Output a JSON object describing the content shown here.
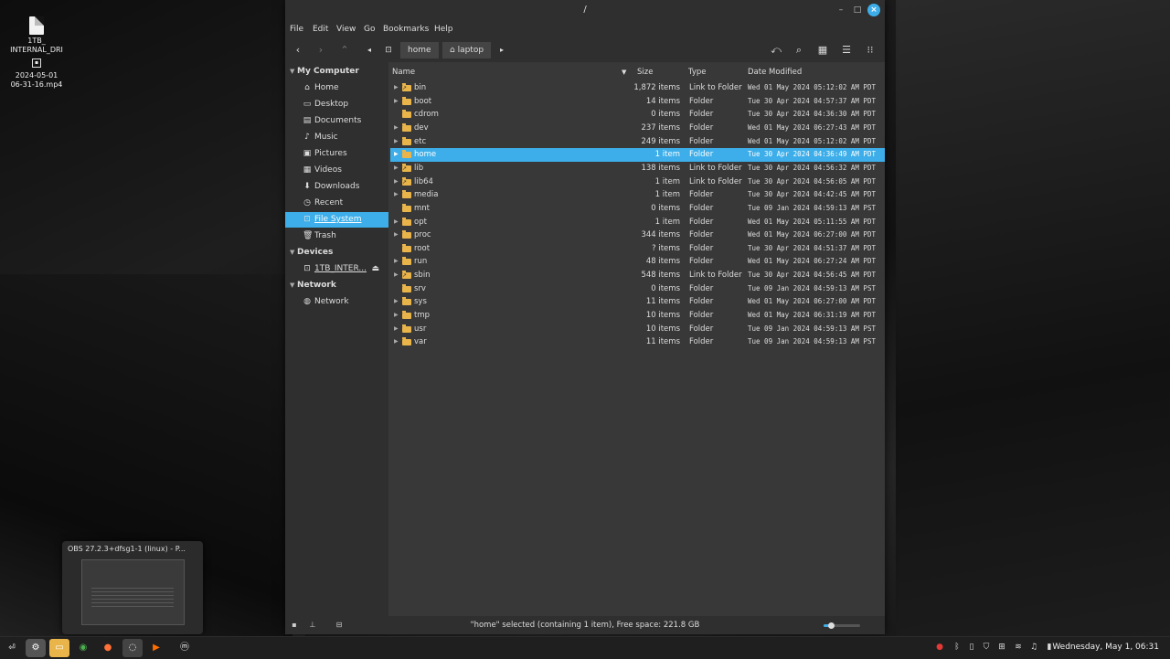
{
  "desktop": {
    "icons": [
      {
        "label": "1TB_\nINTERNAL_DRI"
      },
      {
        "label": "2024-05-01\n06-31-16.mp4"
      }
    ],
    "preview_title": "OBS 27.2.3+dfsg1-1 (linux) - P..."
  },
  "window": {
    "title": "/",
    "menu": [
      "File",
      "Edit",
      "View",
      "Go",
      "Bookmarks",
      "Help"
    ],
    "breadcrumbs": [
      "home",
      "laptop"
    ],
    "sidebar": {
      "sections": [
        {
          "title": "My Computer",
          "items": [
            {
              "label": "Home",
              "icon": "home-icon"
            },
            {
              "label": "Desktop",
              "icon": "desktop-icon"
            },
            {
              "label": "Documents",
              "icon": "documents-icon"
            },
            {
              "label": "Music",
              "icon": "music-icon"
            },
            {
              "label": "Pictures",
              "icon": "pictures-icon"
            },
            {
              "label": "Videos",
              "icon": "videos-icon"
            },
            {
              "label": "Downloads",
              "icon": "downloads-icon"
            },
            {
              "label": "Recent",
              "icon": "recent-icon"
            },
            {
              "label": "File System",
              "icon": "drive-icon",
              "selected": true
            },
            {
              "label": "Trash",
              "icon": "trash-icon"
            }
          ]
        },
        {
          "title": "Devices",
          "items": [
            {
              "label": "1TB_INTER...",
              "icon": "drive-icon",
              "eject": true
            }
          ]
        },
        {
          "title": "Network",
          "items": [
            {
              "label": "Network",
              "icon": "network-icon"
            }
          ]
        }
      ]
    },
    "columns": {
      "name": "Name",
      "size": "Size",
      "type": "Type",
      "date": "Date Modified"
    },
    "rows": [
      {
        "name": "bin",
        "size": "1,872 items",
        "type": "Link to Folder",
        "date": "Wed 01 May 2024 05:12:02 AM PDT",
        "link": true
      },
      {
        "name": "boot",
        "size": "14 items",
        "type": "Folder",
        "date": "Tue 30 Apr 2024 04:57:37 AM PDT"
      },
      {
        "name": "cdrom",
        "size": "0 items",
        "type": "Folder",
        "date": "Tue 30 Apr 2024 04:36:30 AM PDT",
        "noexpand": true
      },
      {
        "name": "dev",
        "size": "237 items",
        "type": "Folder",
        "date": "Wed 01 May 2024 06:27:43 AM PDT"
      },
      {
        "name": "etc",
        "size": "249 items",
        "type": "Folder",
        "date": "Wed 01 May 2024 05:12:02 AM PDT"
      },
      {
        "name": "home",
        "size": "1 item",
        "type": "Folder",
        "date": "Tue 30 Apr 2024 04:36:49 AM PDT",
        "selected": true
      },
      {
        "name": "lib",
        "size": "138 items",
        "type": "Link to Folder",
        "date": "Tue 30 Apr 2024 04:56:32 AM PDT",
        "link": true
      },
      {
        "name": "lib64",
        "size": "1 item",
        "type": "Link to Folder",
        "date": "Tue 30 Apr 2024 04:56:05 AM PDT",
        "link": true
      },
      {
        "name": "media",
        "size": "1 item",
        "type": "Folder",
        "date": "Tue 30 Apr 2024 04:42:45 AM PDT"
      },
      {
        "name": "mnt",
        "size": "0 items",
        "type": "Folder",
        "date": "Tue 09 Jan 2024 04:59:13 AM PST",
        "noexpand": true
      },
      {
        "name": "opt",
        "size": "1 item",
        "type": "Folder",
        "date": "Wed 01 May 2024 05:11:55 AM PDT"
      },
      {
        "name": "proc",
        "size": "344 items",
        "type": "Folder",
        "date": "Wed 01 May 2024 06:27:00 AM PDT"
      },
      {
        "name": "root",
        "size": "? items",
        "type": "Folder",
        "date": "Tue 30 Apr 2024 04:51:37 AM PDT",
        "noexpand": true
      },
      {
        "name": "run",
        "size": "48 items",
        "type": "Folder",
        "date": "Wed 01 May 2024 06:27:24 AM PDT"
      },
      {
        "name": "sbin",
        "size": "548 items",
        "type": "Link to Folder",
        "date": "Tue 30 Apr 2024 04:56:45 AM PDT",
        "link": true
      },
      {
        "name": "srv",
        "size": "0 items",
        "type": "Folder",
        "date": "Tue 09 Jan 2024 04:59:13 AM PST",
        "noexpand": true
      },
      {
        "name": "sys",
        "size": "11 items",
        "type": "Folder",
        "date": "Wed 01 May 2024 06:27:00 AM PDT"
      },
      {
        "name": "tmp",
        "size": "10 items",
        "type": "Folder",
        "date": "Wed 01 May 2024 06:31:19 AM PDT"
      },
      {
        "name": "usr",
        "size": "10 items",
        "type": "Folder",
        "date": "Tue 09 Jan 2024 04:59:13 AM PST"
      },
      {
        "name": "var",
        "size": "11 items",
        "type": "Folder",
        "date": "Tue 09 Jan 2024 04:59:13 AM PST"
      }
    ],
    "status": "\"home\" selected (containing 1 item), Free space: 221.8 GB",
    "zoom_fraction": 0.2
  },
  "taskbar": {
    "clock": "Wednesday, May 1, 06:31"
  },
  "colors": {
    "accent": "#3daee9",
    "folder": "#e9b44a"
  }
}
